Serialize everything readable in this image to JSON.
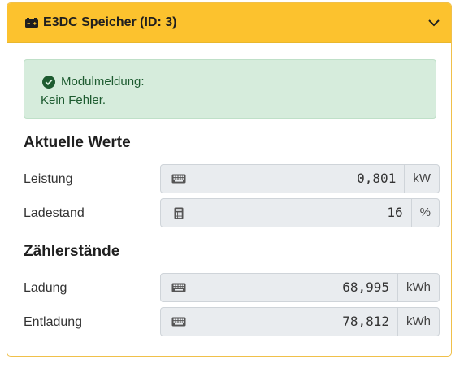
{
  "header": {
    "title": "E3DC Speicher (ID: 3)",
    "icon": "battery-icon",
    "toggle_icon": "chevron-down-icon"
  },
  "alert": {
    "title": "Modulmeldung:",
    "message": "Kein Fehler.",
    "icon": "check-circle-icon"
  },
  "current_values": {
    "title": "Aktuelle Werte",
    "rows": [
      {
        "label": "Leistung",
        "value": "0,801",
        "unit": "kW",
        "icon": "keyboard-icon"
      },
      {
        "label": "Ladestand",
        "value": "16",
        "unit": "%",
        "icon": "calculator-icon"
      }
    ]
  },
  "meter_readings": {
    "title": "Zählerstände",
    "rows": [
      {
        "label": "Ladung",
        "value": "68,995",
        "unit": "kWh",
        "icon": "keyboard-icon"
      },
      {
        "label": "Entladung",
        "value": "78,812",
        "unit": "kWh",
        "icon": "keyboard-icon"
      }
    ]
  },
  "colors": {
    "header_bg": "#fcc22e",
    "alert_bg": "#d6ecdc",
    "alert_text": "#1d5b30",
    "input_bg": "#e9ecef"
  }
}
